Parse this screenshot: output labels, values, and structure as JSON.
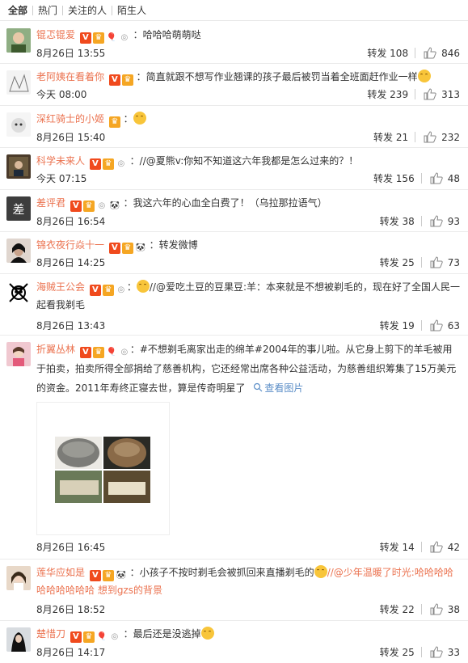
{
  "tabs": [
    "全部",
    "热门",
    "关注的人",
    "陌生人"
  ],
  "comments": [
    {
      "user": "锟忑锟爱",
      "text": "：哈哈哈萌萌哒",
      "time": "8月26日 13:55",
      "repost": "转发 108",
      "likes": "846"
    },
    {
      "user": "老阿姨在看着你",
      "text": "：简直就跟不想写作业翘课的孩子最后被罚当着全班面赶作业一样",
      "time": "今天 08:00",
      "repost": "转发 239",
      "likes": "313"
    },
    {
      "user": "深红骑士的小姬",
      "text": "：",
      "time": "8月26日 15:40",
      "repost": "转发 21",
      "likes": "232"
    },
    {
      "user": "科学未来人",
      "text": "：//@夏熊v:你知不知道这六年我都是怎么过来的？！",
      "time": "今天 07:15",
      "repost": "转发 156",
      "likes": "48"
    },
    {
      "user": "差评君",
      "text": "：我这六年的心血全白费了！（乌拉那拉语气）",
      "time": "8月26日 16:54",
      "repost": "转发 38",
      "likes": "93"
    },
    {
      "user": "锦衣夜行焱十一",
      "text": "：转发微博",
      "time": "8月26日 14:25",
      "repost": "转发 25",
      "likes": "73"
    },
    {
      "user": "海贼王公会",
      "text": "//@爱吃土豆的豆果豆:羊：本来就是不想被剃毛的，现在好了全国人民一起看我剃毛",
      "time": "8月26日 13:43",
      "repost": "转发 19",
      "likes": "63"
    },
    {
      "user": "折翼丛林",
      "text": "：#不想剃毛离家出走的绵羊#2004年的事儿啦。从它身上剪下的羊毛被用于拍卖，拍卖所得全部捐给了慈善机构，它还经常出席各种公益活动，为慈善组织筹集了15万美元的资金。2011年寿终正寝去世，算是传奇明星了",
      "view_pic": "查看图片",
      "time": "8月26日 16:45",
      "repost": "转发 14",
      "likes": "42"
    },
    {
      "user": "莲华应如是",
      "text": "：小孩子不按时剃毛会被抓回来直播剃毛的",
      "text2": "//@少年温暖了时光:哈哈哈哈哈哈哈哈哈哈 想到gzs的背景",
      "time": "8月26日 18:52",
      "repost": "转发 22",
      "likes": "38"
    },
    {
      "user": "楚惜刀",
      "text": "：最后还是没逃掉",
      "time": "8月26日 14:17",
      "repost": "转发 25",
      "likes": "33"
    }
  ],
  "colors": {
    "accent": "#eb7350",
    "text": "#333333",
    "link": "#5b8ec7"
  }
}
